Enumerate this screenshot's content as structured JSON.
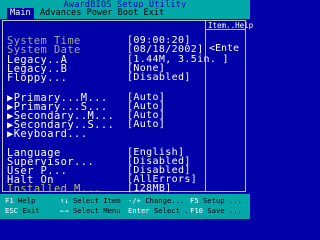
{
  "title": "AwardBIOS Setup Utility",
  "menu": {
    "main": "Main",
    "advanced": "Advances Power Boot Exit"
  },
  "help": {
    "title": "Item..Help",
    "text": "<Ente"
  },
  "items": [
    {
      "label": "System Time",
      "value": "[09:00:20]",
      "style": "sel"
    },
    {
      "label": "System Date",
      "value": "[08/18/2002]",
      "style": "sel"
    },
    {
      "label": "Legacy..A",
      "value": "[1.44M, 3.5in. ]",
      "style": ""
    },
    {
      "label": "Legacy..B",
      "value": "[None]",
      "style": ""
    },
    {
      "label": "Floppy...",
      "value": "[Disabled]",
      "style": ""
    },
    {
      "label": "▶Primary...M...",
      "value": "[Auto]",
      "style": ""
    },
    {
      "label": "▶Primary...S...",
      "value": "[Auto]",
      "style": ""
    },
    {
      "label": "▶Secondary..M...",
      "value": "[Auto]",
      "style": ""
    },
    {
      "label": "▶Secondary..S...",
      "value": "[Auto]",
      "style": ""
    },
    {
      "label": "▶Keyboard...",
      "value": "",
      "style": ""
    },
    {
      "label": "Language",
      "value": "[English]",
      "style": ""
    },
    {
      "label": "Supervisor...",
      "value": "[Disabled]",
      "style": ""
    },
    {
      "label": "User P...",
      "value": "[Disabled]",
      "style": ""
    },
    {
      "label": "Halt On",
      "value": "[AllErrors]",
      "style": ""
    },
    {
      "label": "Installed M...",
      "value": "[128MB]",
      "style": "dim"
    }
  ],
  "footer": [
    {
      "key": "F1",
      "action": "Help"
    },
    {
      "key": "↑↓",
      "action": "Select Item"
    },
    {
      "key": "-/+",
      "action": "Change..."
    },
    {
      "key": "F5",
      "action": "Setup ..."
    },
    {
      "key": "ESC",
      "action": "Exit"
    },
    {
      "key": "←→",
      "action": "Select Menu"
    },
    {
      "key": "Enter",
      "action": "Select ..."
    },
    {
      "key": "F10",
      "action": "Save ..."
    }
  ]
}
